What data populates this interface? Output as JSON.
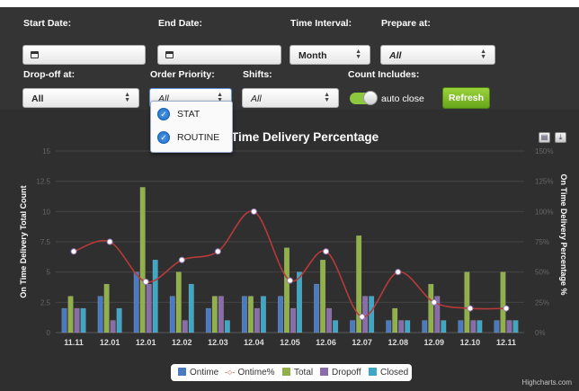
{
  "filters": {
    "start_date": {
      "label": "Start Date:"
    },
    "end_date": {
      "label": "End Date:"
    },
    "time_interval": {
      "label": "Time Interval:",
      "value": "Month"
    },
    "prepare_at": {
      "label": "Prepare at:",
      "value": "All"
    },
    "dropoff_at": {
      "label": "Drop-off at:",
      "value": "All"
    },
    "order_priority": {
      "label": "Order Priority:",
      "value": "All",
      "options": [
        {
          "label": "STAT",
          "checked": true
        },
        {
          "label": "ROUTINE",
          "checked": true
        }
      ]
    },
    "shifts": {
      "label": "Shifts:",
      "value": "All"
    },
    "count_includes": {
      "label": "Count Includes:",
      "toggle_label": "auto close",
      "toggle_on": true
    },
    "refresh_label": "Refresh"
  },
  "colors": {
    "accent_green": "#8dc63f",
    "ontime": "#4a7bc0",
    "ontime_pct": "#b83a3a",
    "total": "#92b04a",
    "dropoff": "#8a6cab",
    "closed": "#3fa6c4"
  },
  "icons": {
    "calendar": "calendar-icon",
    "print": "print-icon",
    "download": "download-icon"
  },
  "chart_data": {
    "type": "bar",
    "title": "Time Delivery Percentage",
    "categories": [
      "11.11",
      "12.01",
      "12.01",
      "12.02",
      "12.03",
      "12.04",
      "12.05",
      "12.06",
      "12.07",
      "12.08",
      "12.09",
      "12.10",
      "12.11"
    ],
    "ylabel": "On Time Delivery Total Count",
    "y2label": "On Time Delivery Percentage %",
    "ylim": [
      0,
      15
    ],
    "yticks": [
      "0",
      "2.5",
      "5",
      "7.5",
      "10",
      "12.5",
      "15"
    ],
    "y2lim": [
      0,
      150
    ],
    "y2ticks": [
      "0%",
      "25%",
      "50%",
      "75%",
      "100%",
      "125%",
      "150%"
    ],
    "grid": true,
    "legend_position": "bottom-center",
    "series": [
      {
        "name": "Ontime",
        "type": "bar",
        "values": [
          2,
          3,
          5,
          3,
          2,
          3,
          3,
          4,
          1,
          1,
          1,
          1,
          1
        ]
      },
      {
        "name": "Total",
        "type": "bar",
        "values": [
          3,
          4,
          12,
          5,
          3,
          3,
          7,
          6,
          8,
          2,
          4,
          5,
          5
        ]
      },
      {
        "name": "Dropoff",
        "type": "bar",
        "values": [
          2,
          1,
          4,
          1,
          3,
          2,
          2,
          2,
          3,
          1,
          3,
          1,
          1
        ]
      },
      {
        "name": "Closed",
        "type": "bar",
        "values": [
          2,
          2,
          6,
          4,
          1,
          3,
          5,
          1,
          3,
          1,
          1,
          1,
          1
        ]
      },
      {
        "name": "Ontime%",
        "type": "spline",
        "axis": "right",
        "values": [
          67,
          75,
          42,
          60,
          67,
          100,
          43,
          67,
          13,
          50,
          25,
          20,
          20
        ]
      }
    ],
    "credit": "Highcharts.com"
  }
}
